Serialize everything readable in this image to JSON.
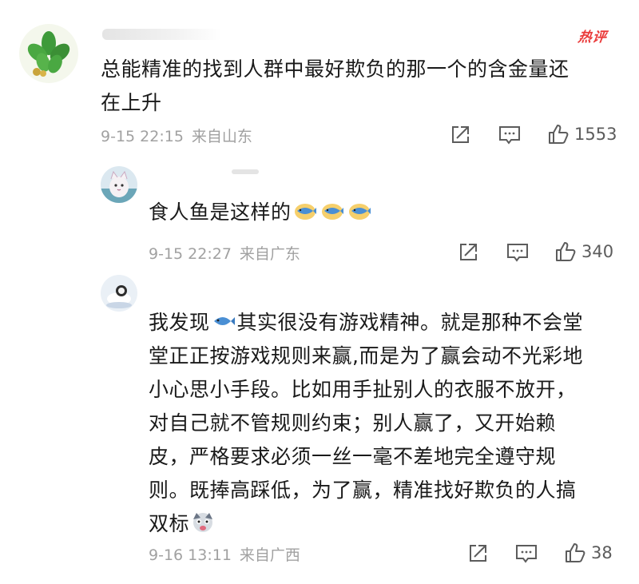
{
  "comments": [
    {
      "hot_label": "热评",
      "text_lines": [
        "总能精准的找到人群中最好欺负的那一个的含金量还",
        "在上升"
      ],
      "date": "9-15 22:15",
      "location": "来自山东",
      "likes": "1553"
    },
    {
      "text": "食人鱼是这样的",
      "date": "9-15 22:27",
      "location": "来自广东",
      "likes": "340"
    },
    {
      "text_lines": [
        "我发现",
        "其实很没有游戏精神。就是那种不会堂",
        "堂正正按游戏规则来赢,而是为了赢会动不光彩地",
        "小心思小手段。比如用手扯别人的衣服不放开，",
        "对自己就不管规则约束；别人赢了，又开始赖",
        "皮，严格要求必须一丝一毫不差地完全遵守规",
        "则。既捧高踩低，为了赢，精准找好欺负的人搞",
        "双标"
      ],
      "date": "9-16 13:11",
      "location": "来自广西",
      "likes": "38"
    }
  ],
  "colors": {
    "hot": "#ea3a3a",
    "meta": "#a1a1a1",
    "text": "#1a1a1a",
    "fish": "#4a8fd4"
  },
  "icons": [
    "share-icon",
    "comment-icon",
    "thumbs-up-icon",
    "praying-hands-fish-emoji",
    "fish-emoji",
    "dog-face-emoji"
  ]
}
